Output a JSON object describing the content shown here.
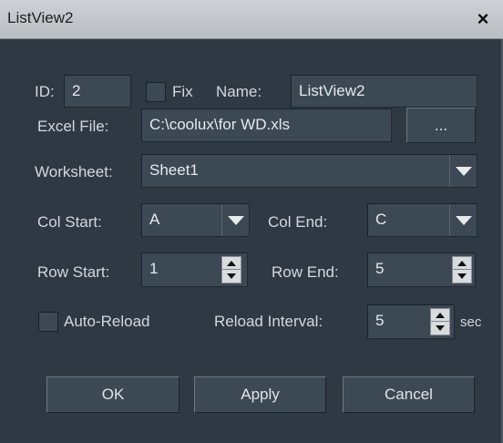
{
  "window": {
    "title": "ListView2",
    "close_glyph": "×"
  },
  "form": {
    "id_label": "ID:",
    "id_value": "2",
    "fix_label": "Fix",
    "fix_checked": false,
    "name_label": "Name:",
    "name_value": "ListView2",
    "excel_label": "Excel File:",
    "excel_value": "C:\\coolux\\for WD.xls",
    "browse_label": "...",
    "worksheet_label": "Worksheet:",
    "worksheet_value": "Sheet1",
    "col_start_label": "Col Start:",
    "col_start_value": "A",
    "col_end_label": "Col End:",
    "col_end_value": "C",
    "row_start_label": "Row Start:",
    "row_start_value": "1",
    "row_end_label": "Row End:",
    "row_end_value": "5",
    "auto_reload_label": "Auto-Reload",
    "auto_reload_checked": false,
    "reload_interval_label": "Reload Interval:",
    "reload_interval_value": "5",
    "reload_unit": "sec"
  },
  "buttons": {
    "ok": "OK",
    "apply": "Apply",
    "cancel": "Cancel"
  },
  "colors": {
    "background": "#2f3944",
    "field": "#3d4855",
    "titlebar": "#c4c8cc",
    "text": "#d4d8dc"
  }
}
